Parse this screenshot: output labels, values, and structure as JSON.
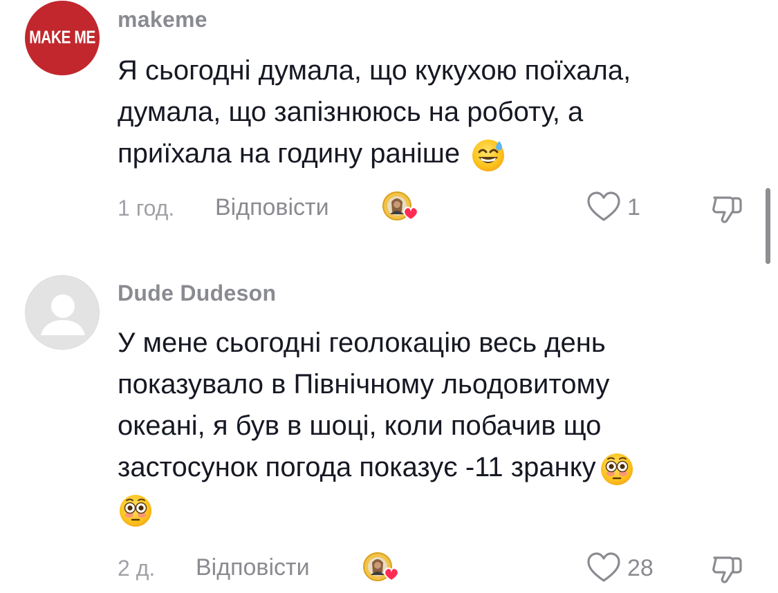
{
  "comments": [
    {
      "username": "makeme",
      "avatar_text": "MAKE ME",
      "avatar_icon": "brand-logo-avatar",
      "text_lines": [
        "Я сьогодні думала, що кукухою поїхала,",
        "думала, що запізнююсь на роботу, а",
        "приїхала на годину раніше"
      ],
      "text_emoji": "grinning-face-with-sweat-emoji",
      "time": "1 год.",
      "reply_label": "Відповісти",
      "creator_liked_icon": "creator-liked-icon",
      "like_count": "1",
      "like_icon": "heart-outline-icon",
      "dislike_icon": "thumbs-down-icon"
    },
    {
      "username": "Dude Dudeson",
      "avatar_icon": "default-user-avatar",
      "text_lines": [
        "У мене сьогодні геолокацію весь день",
        "показувало в Північному льодовитому",
        "океані, я був в шоці, коли побачив що",
        "застосунок погода показує -11 зранку"
      ],
      "text_emoji": "flushed-face-emoji",
      "time": "2 д.",
      "reply_label": "Відповісти",
      "creator_liked_icon": "creator-liked-icon",
      "like_count": "28",
      "like_icon": "heart-outline-icon",
      "dislike_icon": "thumbs-down-icon"
    }
  ],
  "colors": {
    "text": "#161823",
    "secondary": "#8a8b91",
    "brand_avatar": "#c1272d",
    "heart_badge": "#fe2c55",
    "scrollbar": "#8e8e93"
  }
}
